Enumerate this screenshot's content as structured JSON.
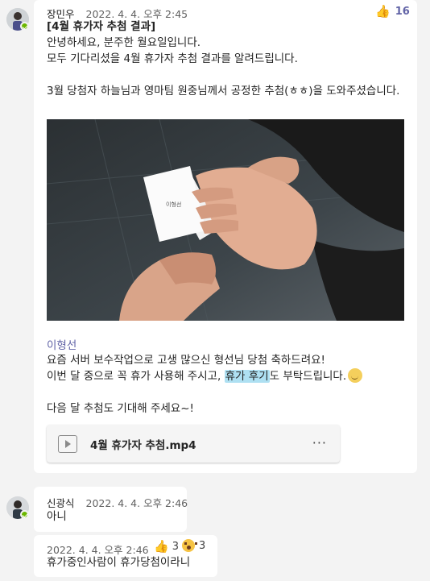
{
  "messages": [
    {
      "author": "장민우",
      "timestamp": "2022. 4. 4. 오후 2:45",
      "reaction": {
        "icon": "thumbs-up-icon",
        "emoji": "👍",
        "count": "16"
      },
      "lines": [
        "[4월 휴가자 추첨 결과]",
        "안녕하세요, 분주한 월요일입니다.",
        "모두 기다리셨을 4월 휴가자 추첨 결과를 알려드립니다.",
        "3월 당첨자 하늘님과 영마팀 원중님께서 공정한 추첨(ㅎㅎ)을 도와주셨습니다."
      ],
      "photo_note_text": "이형선",
      "mention": "이형선",
      "body2": {
        "line1": "요즘 서버 보수작업으로 고생 많으신 형선님 당첨 축하드려요!",
        "line2_pre": "이번 달 중으로 꼭 휴가 사용해 주시고, ",
        "line2_highlight": "휴가 후기",
        "line2_post": "도 부탁드립니다.",
        "line3": "다음 달 추첨도 기대해 주세요~!"
      },
      "attachment": {
        "name": "4월 휴가자 추첨.mp4",
        "more": "···"
      }
    },
    {
      "author": "신광식",
      "timestamp": "2022. 4. 4. 오후 2:46",
      "text": "아니"
    },
    {
      "timestamp": "2022. 4. 4. 오후 2:46",
      "reactions": [
        {
          "icon": "thumbs-up-icon",
          "emoji": "👍",
          "count": "3"
        },
        {
          "icon": "surprised-face-icon",
          "count": "3"
        }
      ],
      "text": "휴가중인사람이 휴가당첨이라니"
    }
  ],
  "colors": {
    "accent": "#6264a7",
    "presence": "#6bb700",
    "highlight": "#aee0f2"
  }
}
